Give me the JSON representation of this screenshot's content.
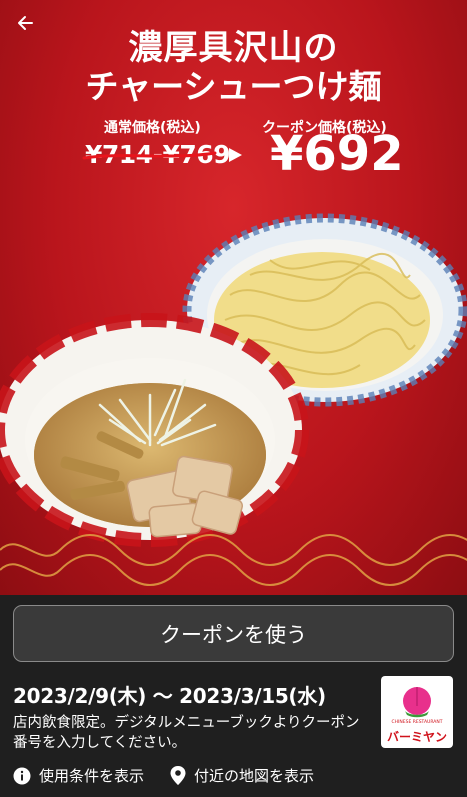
{
  "hero": {
    "title_line1": "濃厚具沢山の",
    "title_line2": "チャーシューつけ麺",
    "regular_price_label": "通常価格(税込)",
    "regular_price": "¥714-¥769",
    "coupon_price_label": "クーポン価格(税込)",
    "coupon_price": "¥692"
  },
  "logo": {
    "brand": "バーミヤン",
    "subtitle": "CHINESE RESTAURANT"
  },
  "coupon": {
    "use_button_label": "クーポンを使う",
    "validity": "2023/2/9(木) 〜 2023/3/15(水)",
    "description": "店内飲食限定。デジタルメニューブックよりクーポン番号を入力してください。"
  },
  "links": {
    "terms_label": "使用条件を表示",
    "map_label": "付近の地図を表示"
  },
  "colors": {
    "hero_red": "#c41a20",
    "brand_red": "#d0121b",
    "bottom_bg": "#1f1f1f"
  },
  "icons": {
    "back": "arrow-left-icon",
    "terms": "info-icon",
    "map": "map-pin-icon"
  }
}
